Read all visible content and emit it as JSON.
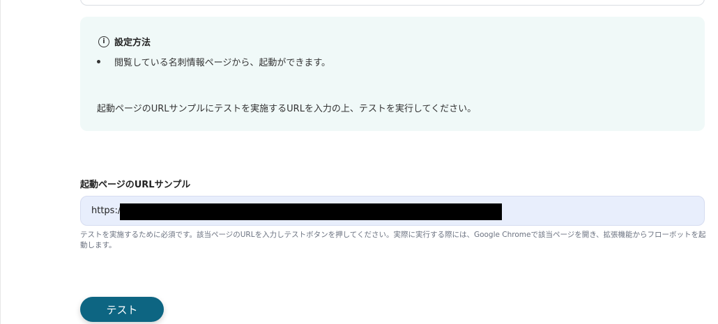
{
  "info": {
    "icon": "info-icon",
    "title": "設定方法",
    "bullets": [
      "閲覧している名刺情報ページから、起動ができます。"
    ],
    "body": "起動ページのURLサンプルにテストを実施するURLを入力の上、テストを実行してください。"
  },
  "url_field": {
    "label": "起動ページのURLサンプル",
    "value": "https:/",
    "help": "テストを実施するために必須です。該当ページのURLを入力しテストボタンを押してください。実際に実行する際には、Google Chromeで該当ページを開き、拡張機能からフローボットを起動します。"
  },
  "test_button": {
    "label": "テスト"
  },
  "colors": {
    "info_bg": "#f0f9f8",
    "input_bg": "#e8eefc",
    "button_bg": "#0d6582"
  }
}
